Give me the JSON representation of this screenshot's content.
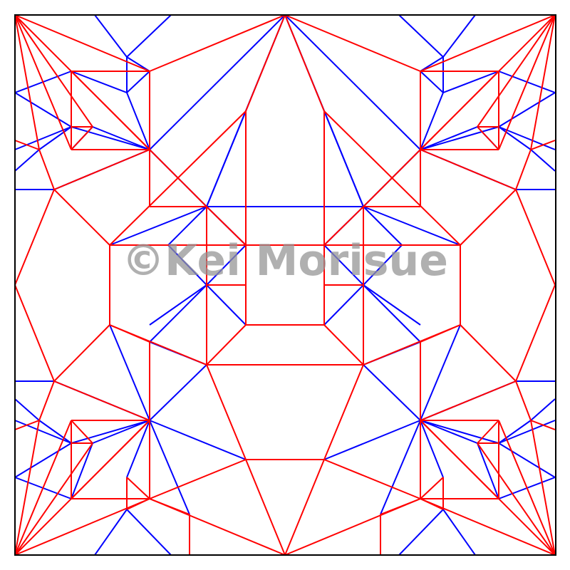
{
  "watermark": {
    "text": "©Kei Morisue"
  },
  "colors": {
    "mountain": "#ff0000",
    "valley": "#0000ff",
    "border": "#000000",
    "background": "#ffffff",
    "watermark": "#969696"
  }
}
